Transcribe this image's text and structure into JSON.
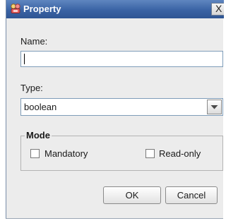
{
  "dialog": {
    "title": "Property",
    "close_label": "X"
  },
  "form": {
    "name_label": "Name:",
    "name_value": "",
    "type_label": "Type:",
    "type_value": "boolean"
  },
  "mode": {
    "legend": "Mode",
    "mandatory_label": "Mandatory",
    "mandatory_checked": false,
    "readonly_label": "Read-only",
    "readonly_checked": false
  },
  "buttons": {
    "ok_label": "OK",
    "cancel_label": "Cancel"
  },
  "icons": {
    "title": "property-icon",
    "dropdown": "chevron-down-icon"
  }
}
